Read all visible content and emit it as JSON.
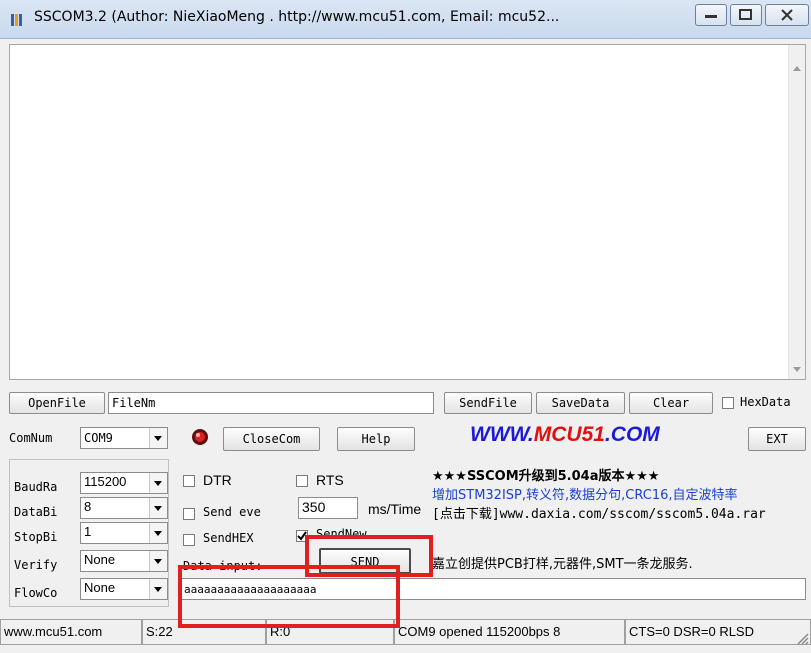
{
  "window": {
    "title": "SSCOM3.2 (Author: NieXiaoMeng . http://www.mcu51.com, Email: mcu52..."
  },
  "file_row": {
    "open_file_label": "OpenFile",
    "file_name_value": "FileNm",
    "send_file_label": "SendFile",
    "save_data_label": "SaveData",
    "clear_label": "Clear",
    "hex_data_label": "HexData",
    "hex_data_checked": false
  },
  "com_row": {
    "com_num_label": "ComNum",
    "com_num_value": "COM9",
    "close_com_label": "CloseCom",
    "help_label": "Help",
    "brand_prefix": "WWW.",
    "brand_middle": "MCU51",
    "brand_suffix": ".COM",
    "exit_label": "EXT"
  },
  "settings": {
    "baud_label": "BaudRa",
    "baud_value": "115200",
    "data_bits_label": "DataBi",
    "data_bits_value": "8",
    "stop_bits_label": "StopBi",
    "stop_bits_value": "1",
    "verify_label": "Verify",
    "verify_value": "None",
    "flow_label": "FlowCo",
    "flow_value": "None"
  },
  "options": {
    "dtr_label": "DTR",
    "dtr_checked": false,
    "rts_label": "RTS",
    "rts_checked": false,
    "send_every_label": "Send eve",
    "send_every_checked": false,
    "interval_value": "350",
    "interval_unit": "ms/Time",
    "send_hex_label": "SendHEX",
    "send_hex_checked": false,
    "send_new_label": "SendNew",
    "send_new_checked": true,
    "data_input_label": "Data input:",
    "send_label": "SEND",
    "input_value": "aaaaaaaaaaaaaaaaaaaa"
  },
  "ad": {
    "line1": "★★★SSCOM升级到5.04a版本★★★",
    "line2": "增加STM32ISP,转义符,数据分句,CRC16,自定波特率",
    "line3": "[点击下载]www.daxia.com/sscom/sscom5.04a.rar",
    "line4": "嘉立创提供PCB打样,元器件,SMT一条龙服务."
  },
  "status": {
    "site": "www.mcu51.com",
    "sent": "S:22",
    "received": "R:0",
    "port_state": "COM9 opened 115200bps 8",
    "signals": "CTS=0 DSR=0 RLSD"
  },
  "colors": {
    "brand_blue": "#1b1bd6",
    "brand_red": "#e01010",
    "ad_blue": "#1a3fd0",
    "highlight_red": "#e02020"
  }
}
